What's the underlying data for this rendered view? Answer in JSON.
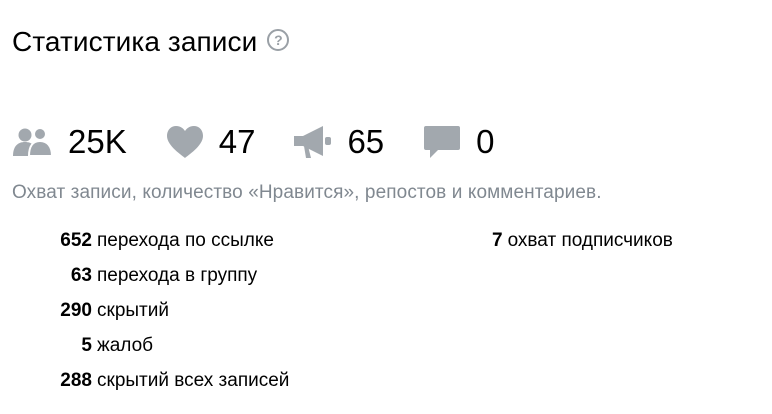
{
  "header": {
    "title": "Статистика записи",
    "help_icon": "question-circle-icon"
  },
  "stats": [
    {
      "icon": "users-icon",
      "value": "25K"
    },
    {
      "icon": "heart-icon",
      "value": "47"
    },
    {
      "icon": "megaphone-icon",
      "value": "65"
    },
    {
      "icon": "comment-icon",
      "value": "0"
    }
  ],
  "description": "Охват записи, количество «Нравится», репостов и комментариев.",
  "details_left": [
    {
      "value": "652",
      "label": "перехода по ссылке"
    },
    {
      "value": "63",
      "label": "перехода в группу"
    },
    {
      "value": "290",
      "label": "скрытий"
    },
    {
      "value": "5",
      "label": "жалоб"
    },
    {
      "value": "288",
      "label": "скрытий всех записей"
    }
  ],
  "details_right": [
    {
      "value": "7",
      "label": "охват подписчиков"
    }
  ],
  "colors": {
    "icon_gray": "#a2a8ae",
    "muted_text": "#808890"
  }
}
